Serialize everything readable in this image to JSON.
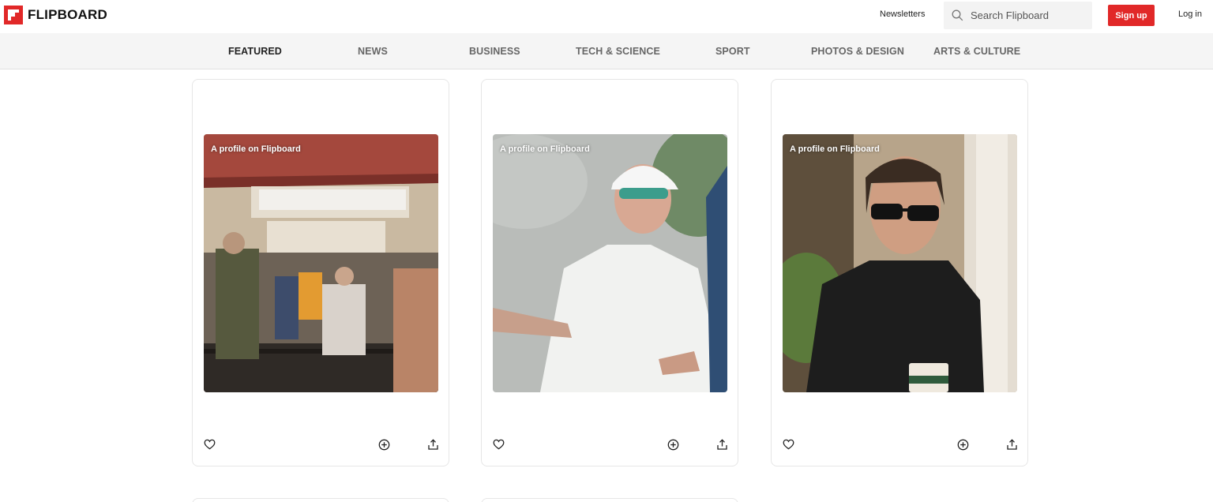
{
  "brand": {
    "name": "FLIPBOARD",
    "color": "#e12828"
  },
  "header": {
    "newsletters": "Newsletters",
    "search_placeholder": "Search Flipboard",
    "signup": "Sign up",
    "login": "Log in"
  },
  "nav": {
    "items": [
      {
        "label": "FEATURED",
        "active": true
      },
      {
        "label": "NEWS",
        "active": false
      },
      {
        "label": "BUSINESS",
        "active": false
      },
      {
        "label": "TECH & SCIENCE",
        "active": false
      },
      {
        "label": "SPORT",
        "active": false
      },
      {
        "label": "PHOTOS & DESIGN",
        "active": false
      },
      {
        "label": "ARTS & CULTURE",
        "active": false
      }
    ]
  },
  "cards": [
    {
      "label": "A profile on Flipboard",
      "icons": [
        "heart-icon",
        "plus-circle-icon",
        "share-icon"
      ]
    },
    {
      "label": "A profile on Flipboard",
      "icons": [
        "heart-icon",
        "plus-circle-icon",
        "share-icon"
      ]
    },
    {
      "label": "A profile on Flipboard",
      "icons": [
        "heart-icon",
        "plus-circle-icon",
        "share-icon"
      ]
    }
  ]
}
